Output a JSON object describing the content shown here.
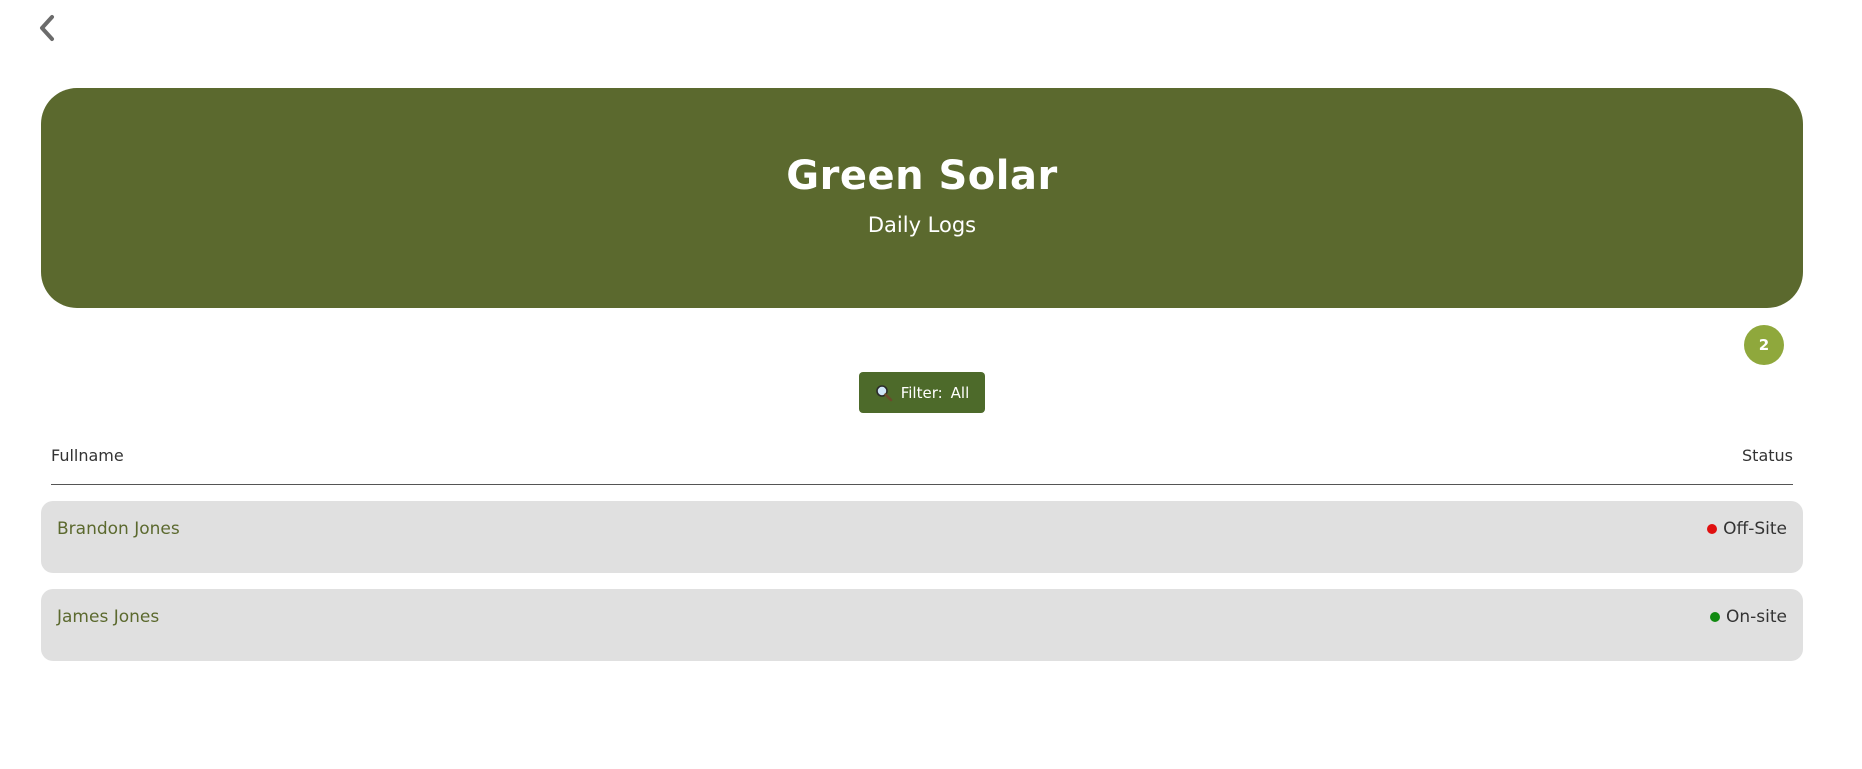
{
  "header": {
    "title": "Green Solar",
    "subtitle": "Daily Logs"
  },
  "badge": {
    "count": "2"
  },
  "filter": {
    "label": "Filter:",
    "value": "All"
  },
  "table": {
    "columns": [
      "Fullname",
      "Status"
    ],
    "rows": [
      {
        "name": "Brandon Jones",
        "status": "Off-Site",
        "status_color": "#e01010"
      },
      {
        "name": "James Jones",
        "status": "On-site",
        "status_color": "#118a11"
      }
    ]
  },
  "colors": {
    "banner": "#5b692e",
    "filter_button": "#4d6a2a",
    "badge": "#8fa83c",
    "row_background": "#e0e0e0"
  },
  "icons": {
    "back": "chevron-left-icon",
    "filter": "magnifier-icon",
    "status": "status-dot-icon"
  }
}
